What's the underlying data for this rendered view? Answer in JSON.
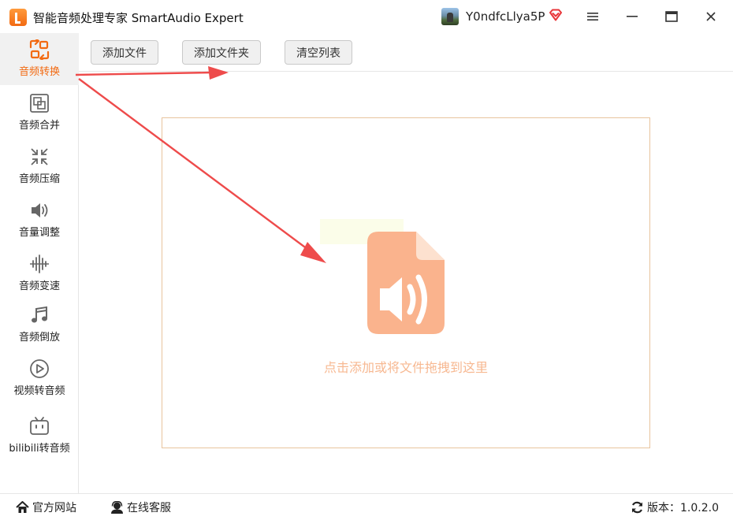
{
  "window": {
    "title": "智能音频处理专家 SmartAudio Expert",
    "username": "Y0ndfcLlya5P"
  },
  "sidebar": {
    "items": [
      {
        "label": "音频转换",
        "icon": "convert-icon",
        "active": true
      },
      {
        "label": "音频合并",
        "icon": "merge-icon"
      },
      {
        "label": "音频压缩",
        "icon": "compress-icon"
      },
      {
        "label": "音量调整",
        "icon": "volume-icon"
      },
      {
        "label": "音频变速",
        "icon": "speed-icon"
      },
      {
        "label": "音频倒放",
        "icon": "reverse-icon"
      },
      {
        "label": "视频转音频",
        "icon": "video-to-audio-icon"
      },
      {
        "label": "bilibili转音频",
        "icon": "bilibili-icon"
      }
    ]
  },
  "toolbar": {
    "add_file": "添加文件",
    "add_folder": "添加文件夹",
    "clear_list": "清空列表"
  },
  "dropzone": {
    "hint": "点击添加或将文件拖拽到这里",
    "icon": "audio-file-icon"
  },
  "statusbar": {
    "website": "官方网站",
    "support": "在线客服",
    "version": "版本：1.0.2.0"
  },
  "colors": {
    "accent": "#f26a12",
    "file_icon": "#fab38d",
    "hint_text": "#f7b891",
    "annotation_arrow": "#ee4b4b"
  }
}
